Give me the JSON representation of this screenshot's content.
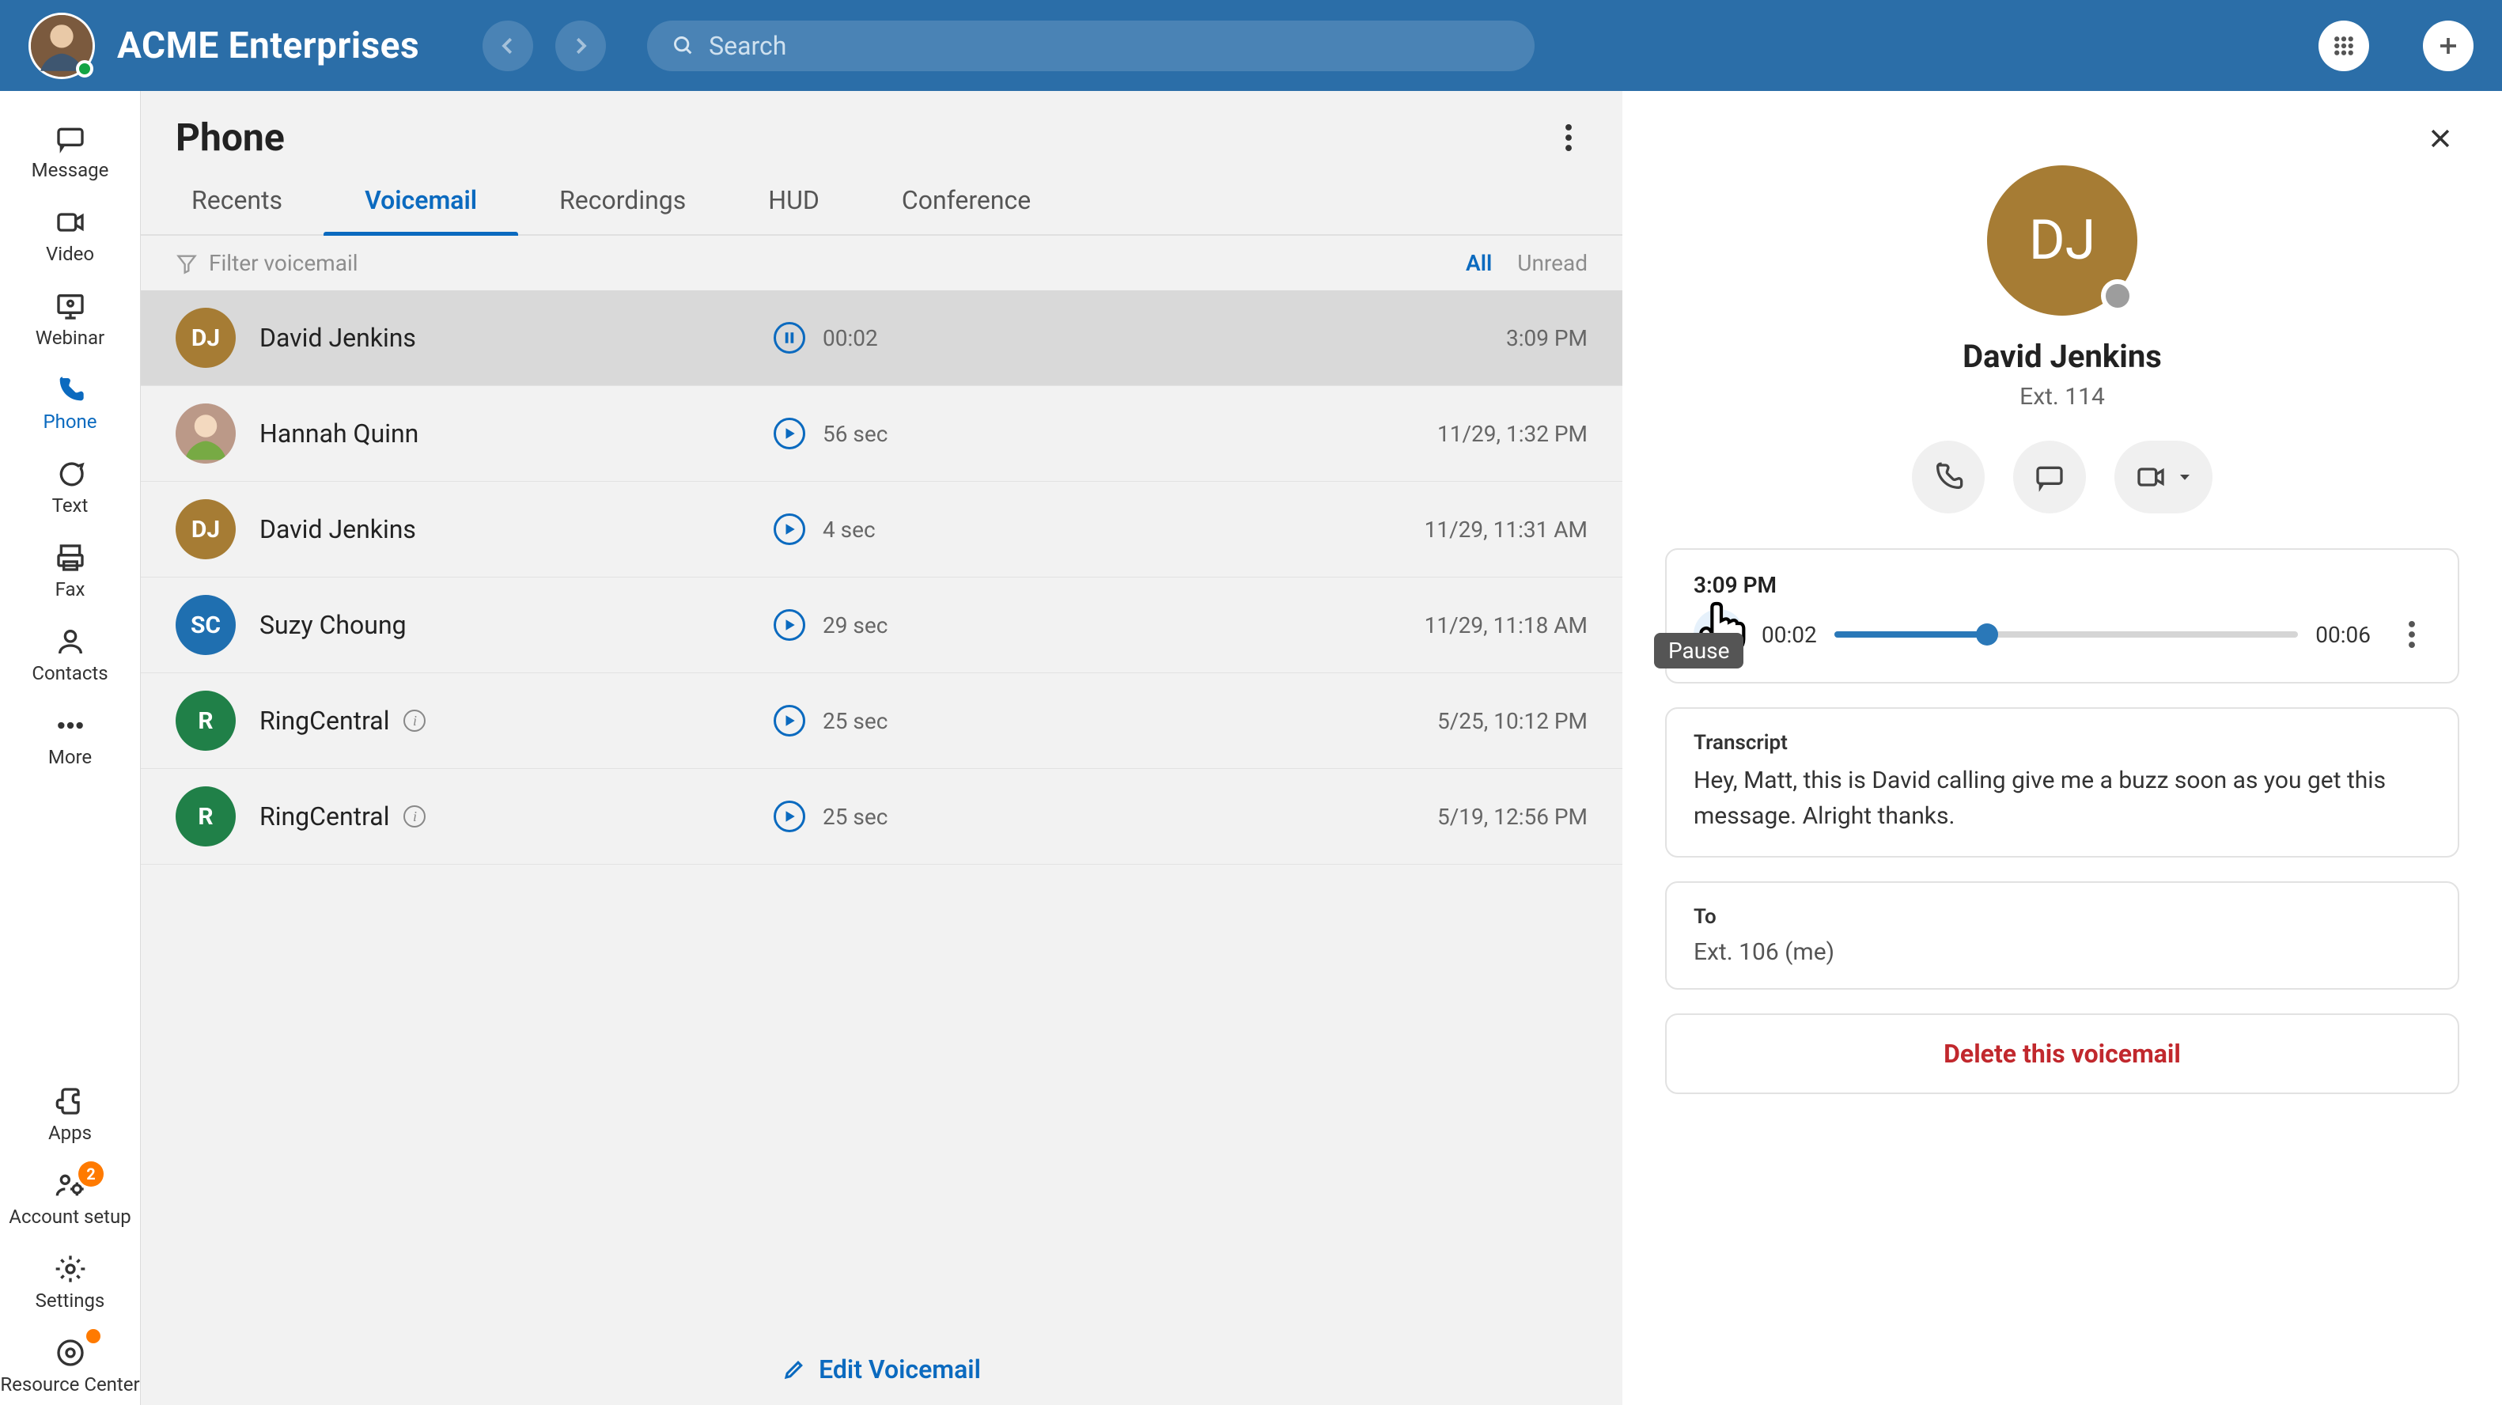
{
  "header": {
    "company": "ACME Enterprises",
    "search_placeholder": "Search"
  },
  "sidebar": {
    "items": [
      {
        "id": "message",
        "label": "Message"
      },
      {
        "id": "video",
        "label": "Video"
      },
      {
        "id": "webinar",
        "label": "Webinar"
      },
      {
        "id": "phone",
        "label": "Phone",
        "active": true
      },
      {
        "id": "text",
        "label": "Text"
      },
      {
        "id": "fax",
        "label": "Fax"
      },
      {
        "id": "contacts",
        "label": "Contacts"
      },
      {
        "id": "more",
        "label": "More"
      }
    ],
    "footer": [
      {
        "id": "apps",
        "label": "Apps"
      },
      {
        "id": "account-setup",
        "label": "Account setup",
        "badge": "2"
      },
      {
        "id": "settings",
        "label": "Settings"
      },
      {
        "id": "resource-center",
        "label": "Resource Center",
        "notif": true
      }
    ]
  },
  "phone": {
    "title": "Phone",
    "tabs": [
      "Recents",
      "Voicemail",
      "Recordings",
      "HUD",
      "Conference"
    ],
    "active_tab": "Voicemail",
    "filter_placeholder": "Filter voicemail",
    "filter_views": {
      "all": "All",
      "unread": "Unread"
    },
    "voicemails": [
      {
        "initials": "DJ",
        "color": "#a67c34",
        "name": "David Jenkins",
        "duration": "00:02",
        "time": "3:09 PM",
        "playing": true,
        "selected": true
      },
      {
        "photo": true,
        "name": "Hannah Quinn",
        "duration": "56 sec",
        "time": "11/29, 1:32 PM"
      },
      {
        "initials": "DJ",
        "color": "#a67c34",
        "name": "David Jenkins",
        "duration": "4 sec",
        "time": "11/29, 11:31 AM"
      },
      {
        "initials": "SC",
        "color": "#1f6fb0",
        "name": "Suzy Choung",
        "duration": "29 sec",
        "time": "11/29, 11:18 AM"
      },
      {
        "initials": "R",
        "color": "#208048",
        "name": "RingCentral",
        "info": true,
        "duration": "25 sec",
        "time": "5/25, 10:12 PM"
      },
      {
        "initials": "R",
        "color": "#208048",
        "name": "RingCentral",
        "info": true,
        "duration": "25 sec",
        "time": "5/19, 12:56 PM"
      }
    ],
    "edit_label": "Edit Voicemail"
  },
  "detail": {
    "initials": "DJ",
    "name": "David Jenkins",
    "extension": "Ext. 114",
    "player": {
      "time_label": "3:09 PM",
      "position": "00:02",
      "duration": "00:06",
      "progress_pct": 33,
      "tooltip": "Pause"
    },
    "transcript_label": "Transcript",
    "transcript": "Hey, Matt, this is David calling give me a buzz soon as you get this message. Alright thanks.",
    "to_label": "To",
    "to_value": "Ext. 106  (me)",
    "delete_label": "Delete this voicemail"
  }
}
